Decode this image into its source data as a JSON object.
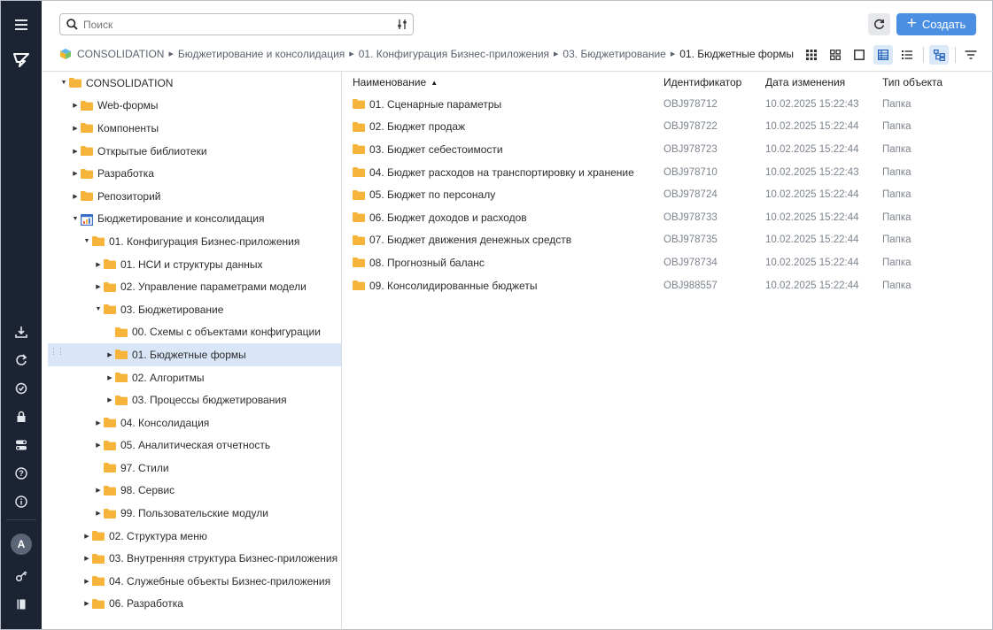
{
  "colors": {
    "rail": "#1c2433",
    "accent": "#4a8fe2",
    "folder": "#f6b53a",
    "selected": "#d8e6f8"
  },
  "rail": {
    "icons": [
      "menu-icon",
      "logo-icon",
      "import-icon",
      "refresh-task-icon",
      "sync-icon",
      "lock-icon",
      "toggle-icon",
      "help-icon",
      "info-icon",
      "key-icon",
      "book-icon"
    ],
    "avatar": "A"
  },
  "search": {
    "placeholder": "Поиск",
    "value": ""
  },
  "toolbar": {
    "create_label": "Создать"
  },
  "breadcrumb": [
    "CONSOLIDATION",
    "Бюджетирование и консолидация",
    "01. Конфигурация Бизнес-приложения",
    "03. Бюджетирование",
    "01. Бюджетные формы"
  ],
  "view": {
    "active_mode": "table",
    "tree_visible": true
  },
  "tree": [
    {
      "label": "CONSOLIDATION",
      "depth": 0,
      "state": "open",
      "icon": "folder"
    },
    {
      "label": "Web-формы",
      "depth": 1,
      "state": "closed",
      "icon": "folder"
    },
    {
      "label": "Компоненты",
      "depth": 1,
      "state": "closed",
      "icon": "folder"
    },
    {
      "label": "Открытые библиотеки",
      "depth": 1,
      "state": "closed",
      "icon": "folder"
    },
    {
      "label": "Разработка",
      "depth": 1,
      "state": "closed",
      "icon": "folder"
    },
    {
      "label": "Репозиторий",
      "depth": 1,
      "state": "closed",
      "icon": "folder"
    },
    {
      "label": "Бюджетирование и консолидация",
      "depth": 1,
      "state": "open",
      "icon": "app"
    },
    {
      "label": "01. Конфигурация Бизнес-приложения",
      "depth": 2,
      "state": "open",
      "icon": "folder"
    },
    {
      "label": "01. НСИ и структуры данных",
      "depth": 3,
      "state": "closed",
      "icon": "folder"
    },
    {
      "label": "02. Управление параметрами модели",
      "depth": 3,
      "state": "closed",
      "icon": "folder"
    },
    {
      "label": "03. Бюджетирование",
      "depth": 3,
      "state": "open",
      "icon": "folder"
    },
    {
      "label": "00. Схемы с объектами конфигурации",
      "depth": 4,
      "state": "leaf",
      "icon": "folder"
    },
    {
      "label": "01. Бюджетные формы",
      "depth": 4,
      "state": "closed",
      "icon": "folder",
      "selected": true
    },
    {
      "label": "02. Алгоритмы",
      "depth": 4,
      "state": "closed",
      "icon": "folder"
    },
    {
      "label": "03. Процессы бюджетирования",
      "depth": 4,
      "state": "closed",
      "icon": "folder"
    },
    {
      "label": "04. Консолидация",
      "depth": 3,
      "state": "closed",
      "icon": "folder"
    },
    {
      "label": "05. Аналитическая отчетность",
      "depth": 3,
      "state": "closed",
      "icon": "folder"
    },
    {
      "label": "97. Стили",
      "depth": 3,
      "state": "leaf",
      "icon": "folder"
    },
    {
      "label": "98. Сервис",
      "depth": 3,
      "state": "closed",
      "icon": "folder"
    },
    {
      "label": "99. Пользовательские модули",
      "depth": 3,
      "state": "closed",
      "icon": "folder"
    },
    {
      "label": "02. Структура меню",
      "depth": 2,
      "state": "closed",
      "icon": "folder"
    },
    {
      "label": "03. Внутренняя структура Бизнес-приложения",
      "depth": 2,
      "state": "closed",
      "icon": "folder"
    },
    {
      "label": "04. Служебные объекты Бизнес-приложения",
      "depth": 2,
      "state": "closed",
      "icon": "folder"
    },
    {
      "label": "06. Разработка",
      "depth": 2,
      "state": "closed",
      "icon": "folder"
    }
  ],
  "table": {
    "columns": [
      "Наименование",
      "Идентификатор",
      "Дата изменения",
      "Тип объекта"
    ],
    "sort": {
      "column": "Наименование",
      "direction": "asc"
    },
    "rows": [
      {
        "name": "01. Сценарные параметры",
        "id": "OBJ978712",
        "date": "10.02.2025 15:22:43",
        "type": "Папка"
      },
      {
        "name": "02. Бюджет продаж",
        "id": "OBJ978722",
        "date": "10.02.2025 15:22:44",
        "type": "Папка"
      },
      {
        "name": "03. Бюджет себестоимости",
        "id": "OBJ978723",
        "date": "10.02.2025 15:22:44",
        "type": "Папка"
      },
      {
        "name": "04. Бюджет расходов на транспортировку и хранение",
        "id": "OBJ978710",
        "date": "10.02.2025 15:22:43",
        "type": "Папка"
      },
      {
        "name": "05. Бюджет по персоналу",
        "id": "OBJ978724",
        "date": "10.02.2025 15:22:44",
        "type": "Папка"
      },
      {
        "name": "06. Бюджет доходов и расходов",
        "id": "OBJ978733",
        "date": "10.02.2025 15:22:44",
        "type": "Папка"
      },
      {
        "name": "07. Бюджет движения денежных средств",
        "id": "OBJ978735",
        "date": "10.02.2025 15:22:44",
        "type": "Папка"
      },
      {
        "name": "08. Прогнозный баланс",
        "id": "OBJ978734",
        "date": "10.02.2025 15:22:44",
        "type": "Папка"
      },
      {
        "name": "09. Консолидированные бюджеты",
        "id": "OBJ988557",
        "date": "10.02.2025 15:22:44",
        "type": "Папка"
      }
    ]
  }
}
